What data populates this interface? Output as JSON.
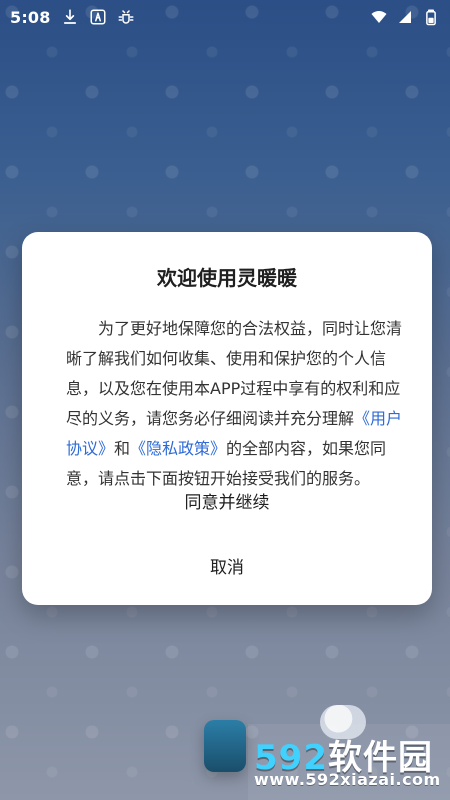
{
  "status_bar": {
    "time": "5:08",
    "icons_left": [
      "download-icon",
      "a-icon",
      "bug-icon"
    ],
    "icons_right": [
      "wifi-icon",
      "signal-icon",
      "battery-icon"
    ]
  },
  "dialog": {
    "title": "欢迎使用灵暖暖",
    "body_parts": {
      "p1": "为了更好地保障您的合法权益，同时让您清晰了解我们如何收集、使用和保护您的个人信息，以及您在使用本APP过程中享有的权利和应尽的义务，请您务必仔细阅读并充分理解",
      "link1": "《用户协议》",
      "and": "和",
      "link2": "《隐私政策》",
      "p2": "的全部内容，如果您同意，请点击下面按钮开始接受我们的服务。"
    },
    "agree_label": "同意并继续",
    "cancel_label": "取消"
  },
  "watermark": {
    "brand_num": "592",
    "brand_text": "软件园",
    "url": "www.592xiazai.com"
  },
  "colors": {
    "link": "#2e6bd6",
    "watermark_num": "#40d1ff"
  }
}
